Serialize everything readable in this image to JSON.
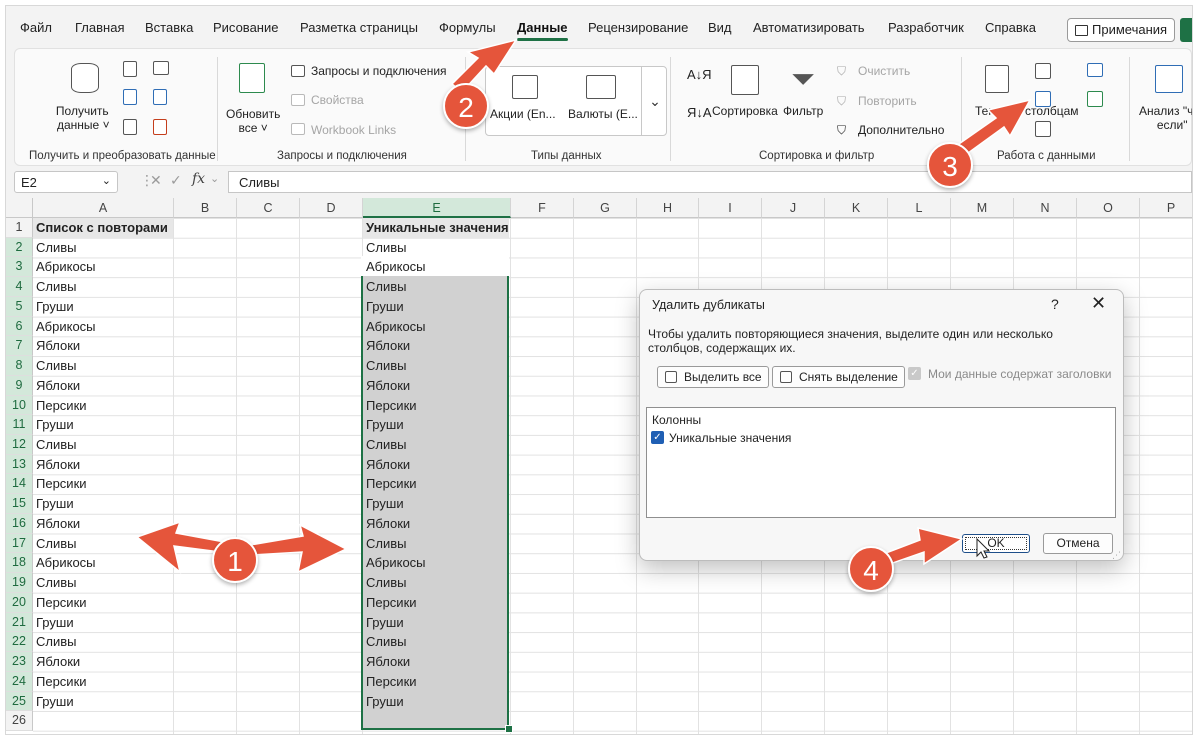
{
  "ribbon_tabs": [
    "Файл",
    "Главная",
    "Вставка",
    "Рисование",
    "Разметка страницы",
    "Формулы",
    "Данные",
    "Рецензирование",
    "Вид",
    "Автоматизировать",
    "Разработчик",
    "Справка"
  ],
  "active_tab": "Данные",
  "notes_button": "Примечания",
  "groups": {
    "get_data": {
      "label": "Получить и преобразовать данные",
      "button_line1": "Получить",
      "button_line2": "данные"
    },
    "queries": {
      "label": "Запросы и подключения",
      "refresh_line1": "Обновить",
      "refresh_line2": "все",
      "items": [
        "Запросы и подключения",
        "Свойства",
        "Workbook Links"
      ]
    },
    "data_types": {
      "label": "Типы данных",
      "items": [
        "Акции (En...",
        "Валюты (E..."
      ]
    },
    "sort_filter": {
      "label": "Сортировка и фильтр",
      "sort": "Сортировка",
      "filter": "Фильтр",
      "items": [
        "Очистить",
        "Повторить",
        "Дополнительно"
      ]
    },
    "data_tools": {
      "label": "Работа с данными",
      "text_to_columns": "Текст по столбцам"
    },
    "forecast": {
      "analysis_line1": "Анализ \"что",
      "analysis_line2": "если\""
    }
  },
  "formula_bar": {
    "name_box": "E2",
    "fx": "fx",
    "value": "Сливы"
  },
  "columns": [
    "A",
    "B",
    "C",
    "D",
    "E",
    "F",
    "G",
    "H",
    "I",
    "J",
    "K",
    "L",
    "M",
    "N",
    "O",
    "P"
  ],
  "row_numbers": [
    "1",
    "2",
    "3",
    "4",
    "5",
    "6",
    "7",
    "8",
    "9",
    "10",
    "11",
    "12",
    "13",
    "14",
    "15",
    "16",
    "17",
    "18",
    "19",
    "20",
    "21",
    "22",
    "23",
    "24",
    "25",
    "26"
  ],
  "sheet": {
    "col_a_header": "Список с повторами",
    "col_e_header": "Уникальные значения",
    "col_a_values": [
      "Сливы",
      "Абрикосы",
      "Сливы",
      "Груши",
      "Абрикосы",
      "Яблоки",
      "Сливы",
      "Яблоки",
      "Персики",
      "Груши",
      "Сливы",
      "Яблоки",
      "Персики",
      "Груши",
      "Яблоки",
      "Сливы",
      "Абрикосы",
      "Сливы",
      "Персики",
      "Груши",
      "Сливы",
      "Яблоки",
      "Персики",
      "Груши"
    ],
    "col_e_values": [
      "Сливы",
      "Абрикосы",
      "Сливы",
      "Груши",
      "Абрикосы",
      "Яблоки",
      "Сливы",
      "Яблоки",
      "Персики",
      "Груши",
      "Сливы",
      "Яблоки",
      "Персики",
      "Груши",
      "Яблоки",
      "Сливы",
      "Абрикосы",
      "Сливы",
      "Персики",
      "Груши",
      "Сливы",
      "Яблоки",
      "Персики",
      "Груши"
    ]
  },
  "dialog": {
    "title": "Удалить дубликаты",
    "help": "?",
    "close": "✕",
    "description": "Чтобы удалить повторяющиеся значения, выделите один или несколько столбцов, содержащих их.",
    "select_all": "Выделить все",
    "unselect_all": "Снять выделение",
    "has_headers": "Мои данные содержат заголовки",
    "columns_title": "Колонны",
    "column_item": "Уникальные значения",
    "ok": "OK",
    "cancel": "Отмена"
  },
  "callouts": [
    "1",
    "2",
    "3",
    "4"
  ],
  "colors": {
    "accent_green": "#1e7145",
    "callout_red": "#e5553b",
    "selection_fill": "#d1d1d1",
    "checkbox_blue": "#1f5fb4"
  }
}
